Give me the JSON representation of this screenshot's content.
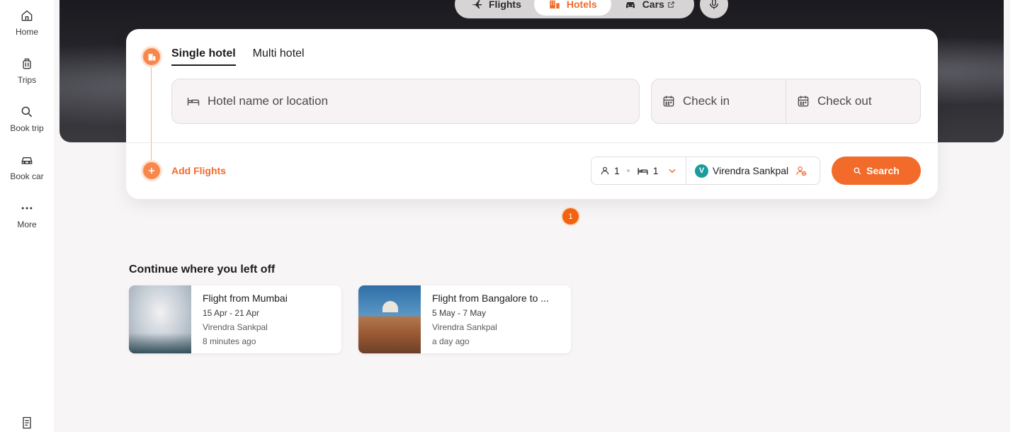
{
  "sidebar": {
    "items": [
      {
        "label": "Home",
        "icon": "home-icon"
      },
      {
        "label": "Trips",
        "icon": "luggage-icon"
      },
      {
        "label": "Book trip",
        "icon": "search-icon"
      },
      {
        "label": "Book car",
        "icon": "car-icon"
      },
      {
        "label": "More",
        "icon": "more-dots-icon"
      }
    ],
    "bottom_icon": "receipt-icon"
  },
  "mode_tabs": {
    "flights": "Flights",
    "hotels": "Hotels",
    "cars": "Cars",
    "active": "Hotels"
  },
  "search": {
    "tabs": [
      "Single hotel",
      "Multi hotel"
    ],
    "active_tab": "Single hotel",
    "hotel_placeholder": "Hotel name or location",
    "check_in": "Check in",
    "check_out": "Check out",
    "add_flights": "Add Flights",
    "adults": "1",
    "rooms": "1",
    "traveller_initial": "V",
    "traveller_name": "Virendra Sankpal",
    "search_label": "Search"
  },
  "pagination_badge": "1",
  "recent": {
    "title": "Continue where you left off",
    "cards": [
      {
        "title": "Flight from Mumbai",
        "dates": "15 Apr - 21 Apr",
        "traveller": "Virendra Sankpal",
        "time": "8 minutes ago"
      },
      {
        "title": "Flight from Bangalore to ...",
        "dates": "5 May - 7 May",
        "traveller": "Virendra Sankpal",
        "time": "a day ago"
      }
    ]
  },
  "colors": {
    "accent": "#f26b2a",
    "avatar": "#1b9c9c"
  }
}
